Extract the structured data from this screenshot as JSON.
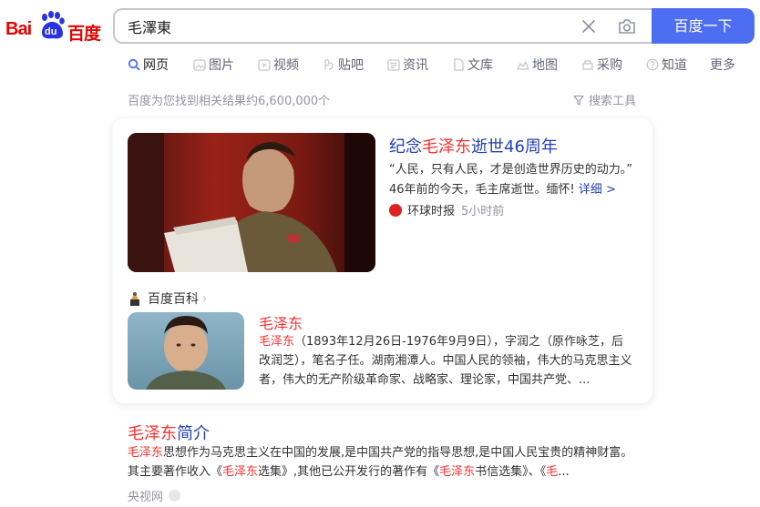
{
  "header": {
    "logo_bai": "Bai",
    "logo_du": "du",
    "logo_cn": "百度",
    "search_value": "毛澤東",
    "search_button": "百度一下"
  },
  "tabs": [
    {
      "label": "网页",
      "icon": "search-icon",
      "active": true
    },
    {
      "label": "图片",
      "icon": "image-icon"
    },
    {
      "label": "视频",
      "icon": "video-icon"
    },
    {
      "label": "贴吧",
      "icon": "tieba-icon"
    },
    {
      "label": "资讯",
      "icon": "news-icon"
    },
    {
      "label": "文库",
      "icon": "doc-icon"
    },
    {
      "label": "地图",
      "icon": "map-icon"
    },
    {
      "label": "采购",
      "icon": "purchase-icon"
    },
    {
      "label": "知道",
      "icon": "question-icon"
    },
    {
      "label": "更多"
    }
  ],
  "result_count": "百度为您找到相关结果约6,600,000个",
  "filter_tool": "搜索工具",
  "news_card": {
    "title_pre": "纪念",
    "title_hl": "毛泽东",
    "title_post": "逝世46周年",
    "desc_line1": "“人民，只有人民，才是创造世界历史的动力。”",
    "desc_line2": "46年前的今天，毛主席逝世。缅怀!",
    "more": "详细 >",
    "source": "环球时报",
    "time": "5小时前"
  },
  "baike": {
    "header": "百度百科",
    "title": "毛泽东",
    "desc_hl": "毛泽东",
    "desc": "（1893年12月26日-1976年9月9日），字润之（原作咏芝，后改润芝），笔名子任。湖南湘潭人。中国人民的领袖，伟大的马克思主义者，伟大的无产阶级革命家、战略家、理论家，中国共产党、..."
  },
  "result2": {
    "title_hl": "毛泽东",
    "title_post": "简介",
    "desc_hl1": "毛泽东",
    "desc_1": "思想作为马克思主义在中国的发展,是中国共产党的指导思想,是中国人民宝贵的精神财富。",
    "desc_2a": "其主要著作收入《",
    "desc_hl2": "毛泽东",
    "desc_2b": "选集》,其他已公开发行的著作有《",
    "desc_hl3": "毛泽东",
    "desc_2c": "书信选集》、《",
    "desc_hl4": "毛",
    "desc_2d": "...",
    "source": "央视网"
  },
  "colors": {
    "brand_blue": "#4e6ef2",
    "link_blue": "#2440b3",
    "highlight_red": "#f73131",
    "logo_red": "#e10602"
  }
}
